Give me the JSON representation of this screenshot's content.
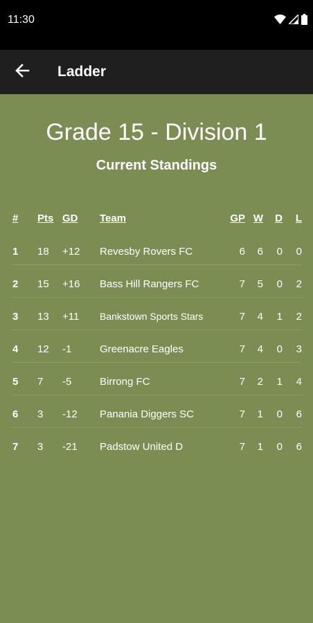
{
  "status_bar": {
    "time": "11:30",
    "icons": [
      "wifi-icon",
      "signal-icon",
      "battery-icon"
    ]
  },
  "app_bar": {
    "back_icon": "arrow-back-icon",
    "title": "Ladder"
  },
  "page": {
    "grade_title": "Grade 15 - Division 1",
    "standings_title": "Current Standings"
  },
  "table": {
    "headers": {
      "rank": "#",
      "pts": "Pts",
      "gd": "GD",
      "team": "Team",
      "gp": "GP",
      "w": "W",
      "d": "D",
      "l": "L"
    },
    "rows": [
      {
        "rank": "1",
        "pts": "18",
        "gd": "+12",
        "team": "Revesby Rovers FC",
        "gp": "6",
        "w": "6",
        "d": "0",
        "l": "0"
      },
      {
        "rank": "2",
        "pts": "15",
        "gd": "+16",
        "team": "Bass Hill Rangers FC",
        "gp": "7",
        "w": "5",
        "d": "0",
        "l": "2"
      },
      {
        "rank": "3",
        "pts": "13",
        "gd": "+11",
        "team": "Bankstown Sports Stars",
        "gp": "7",
        "w": "4",
        "d": "1",
        "l": "2"
      },
      {
        "rank": "4",
        "pts": "12",
        "gd": "-1",
        "team": "Greenacre Eagles",
        "gp": "7",
        "w": "4",
        "d": "0",
        "l": "3"
      },
      {
        "rank": "5",
        "pts": "7",
        "gd": "-5",
        "team": "Birrong FC",
        "gp": "7",
        "w": "2",
        "d": "1",
        "l": "4"
      },
      {
        "rank": "6",
        "pts": "3",
        "gd": "-12",
        "team": "Panania Diggers SC",
        "gp": "7",
        "w": "1",
        "d": "0",
        "l": "6"
      },
      {
        "rank": "7",
        "pts": "3",
        "gd": "-21",
        "team": "Padstow United D",
        "gp": "7",
        "w": "1",
        "d": "0",
        "l": "6"
      }
    ]
  },
  "colors": {
    "background": "#7b8d53",
    "app_bar": "#1f1f1f",
    "status_bar": "#000000",
    "text": "#ffffff"
  }
}
